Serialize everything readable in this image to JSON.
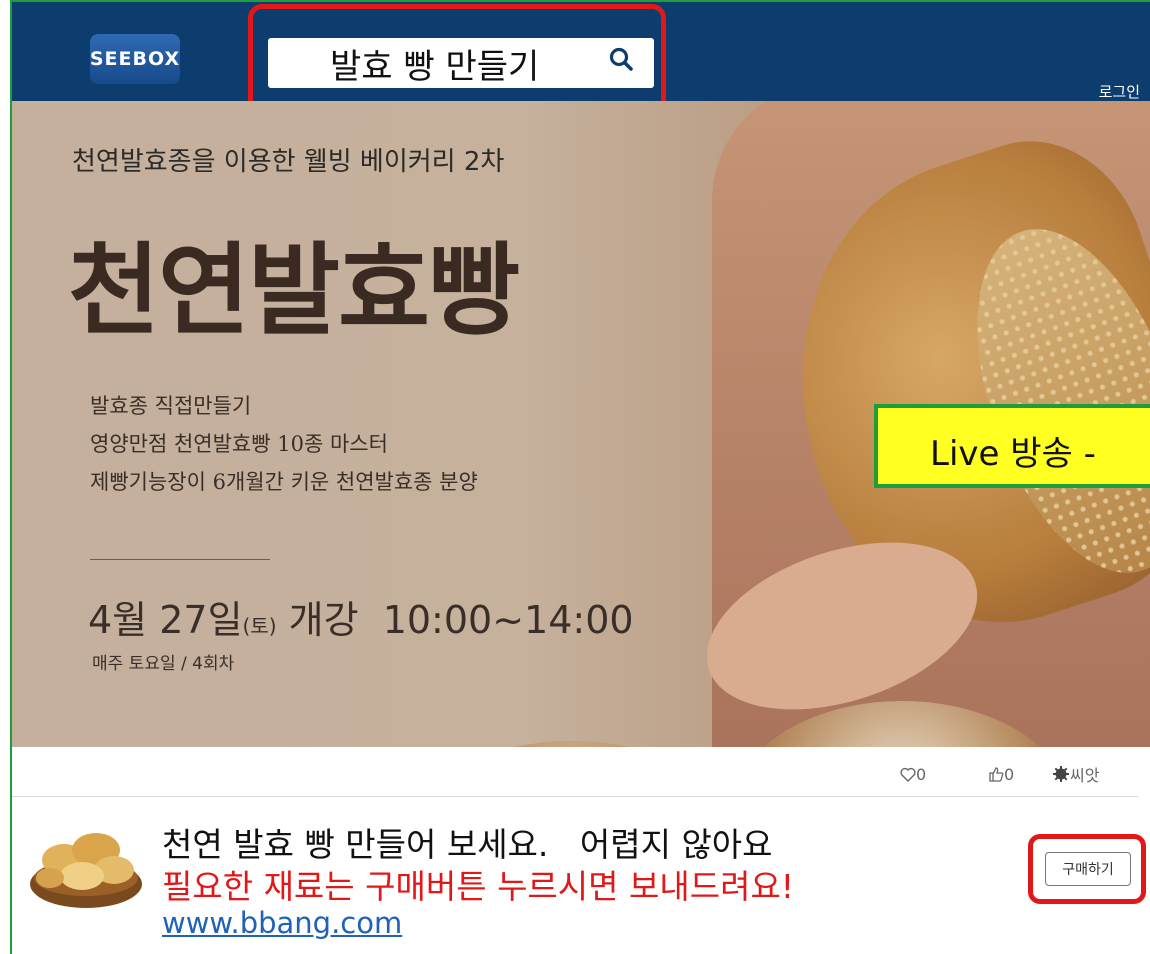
{
  "header": {
    "logo_text": "SEEBOX",
    "search_value": "발효 빵 만들기",
    "login_label": "로그인",
    "colors": {
      "header_bg": "#0d3d6e",
      "highlight": "#e01818"
    }
  },
  "banner": {
    "subtitle": "천연발효종을 이용한 웰빙 베이커리 2차",
    "title": "천연발효빵",
    "lines": [
      "발효종 직접만들기",
      "영양만점 천연발효빵 10종 마스터",
      "제빵기능장이 6개월간 키운 천연발효종 분양"
    ],
    "date_main": "4월 27일",
    "date_day": "(토)",
    "date_rest": " 개강  10:00~14:00",
    "schedule": "매주 토요일 / 4회차",
    "live_label": "Live 방송 -"
  },
  "stats": {
    "likes": "0",
    "thumbs": "0",
    "seed_label": "씨앗"
  },
  "post": {
    "line1": "천연 발효 빵 만들어 보세요.   어렵지 않아요",
    "line2": "필요한 재료는 구매버튼 누르시면 보내드려요!",
    "link": "www.bbang.com",
    "buy_label": "구매하기"
  }
}
